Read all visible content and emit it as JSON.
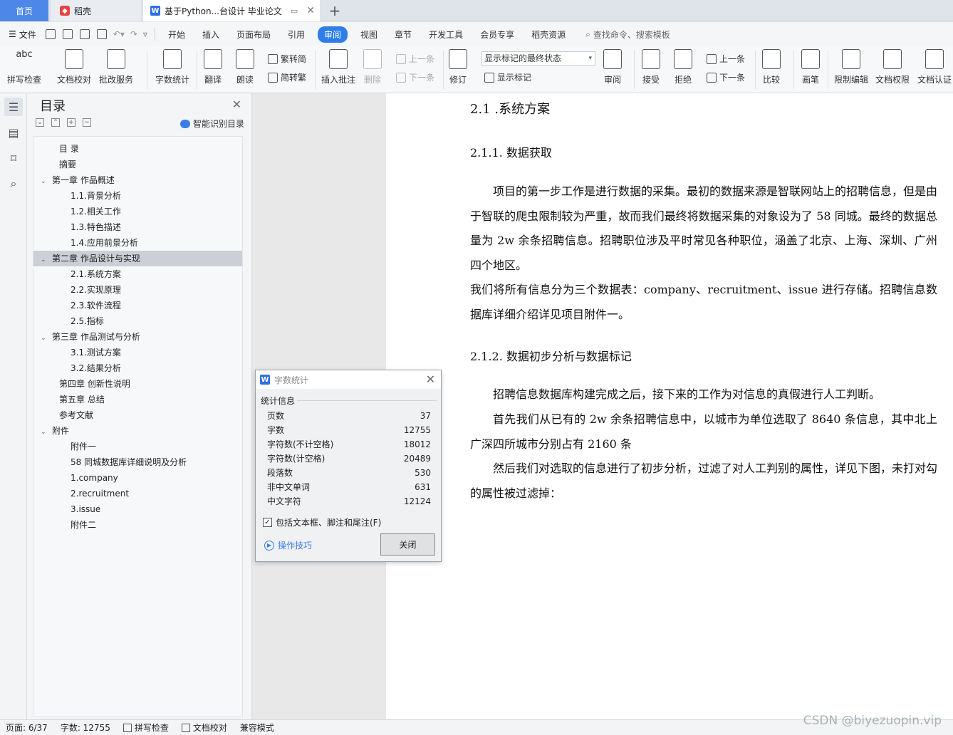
{
  "tabs": {
    "home": "首页",
    "daoke": "稻壳",
    "doc": "基于Python...台设计 毕业论文",
    "add": "+"
  },
  "menu": {
    "file": "文件",
    "items": [
      "开始",
      "插入",
      "页面布局",
      "引用",
      "审阅",
      "视图",
      "章节",
      "开发工具",
      "会员专享",
      "稻壳资源"
    ],
    "active": "审阅",
    "search": "查找命令、搜索模板"
  },
  "ribbon": {
    "spell": "拼写检查",
    "doccheck": "文档校对",
    "batch": "批改服务",
    "wordcount": "字数统计",
    "translate": "翻译",
    "read": "朗读",
    "trad": "繁转简",
    "simp": "简转繁",
    "insert_comment": "插入批注",
    "delete": "删除",
    "prev": "上一条",
    "next": "下一条",
    "revise": "修订",
    "display_select": "显示标记的最终状态",
    "show_markup": "显示标记",
    "review": "审阅",
    "accept": "接受",
    "reject": "拒绝",
    "prev2": "上一条",
    "next2": "下一条",
    "compare": "比较",
    "pen": "画笔",
    "restrict": "限制编辑",
    "rights": "文档权限",
    "auth": "文档认证",
    "abc": "abc"
  },
  "toc": {
    "title": "目录",
    "smart": "智能识别目录",
    "items": [
      {
        "label": "目 录",
        "level": 0,
        "arrow": ""
      },
      {
        "label": "摘要",
        "level": 0,
        "arrow": ""
      },
      {
        "label": "第一章 作品概述",
        "level": 0,
        "arrow": "v"
      },
      {
        "label": "1.1.背景分析",
        "level": 1,
        "arrow": ""
      },
      {
        "label": "1.2.相关工作",
        "level": 1,
        "arrow": ""
      },
      {
        "label": "1.3.特色描述",
        "level": 1,
        "arrow": ""
      },
      {
        "label": "1.4.应用前景分析",
        "level": 1,
        "arrow": ""
      },
      {
        "label": "第二章 作品设计与实现",
        "level": 0,
        "arrow": "v",
        "selected": true
      },
      {
        "label": "2.1.系统方案",
        "level": 1,
        "arrow": ""
      },
      {
        "label": "2.2.实现原理",
        "level": 1,
        "arrow": ""
      },
      {
        "label": "2.3.软件流程",
        "level": 1,
        "arrow": ""
      },
      {
        "label": "2.5.指标",
        "level": 1,
        "arrow": ""
      },
      {
        "label": "第三章 作品测试与分析",
        "level": 0,
        "arrow": "v"
      },
      {
        "label": "3.1.测试方案",
        "level": 1,
        "arrow": ""
      },
      {
        "label": "3.2.结果分析",
        "level": 1,
        "arrow": ""
      },
      {
        "label": "第四章 创新性说明",
        "level": 0,
        "arrow": ""
      },
      {
        "label": "第五章 总结",
        "level": 0,
        "arrow": ""
      },
      {
        "label": "参考文献",
        "level": 0,
        "arrow": ""
      },
      {
        "label": "附件",
        "level": 0,
        "arrow": "v"
      },
      {
        "label": "附件一",
        "level": 1,
        "arrow": ""
      },
      {
        "label": "58 同城数据库详细说明及分析",
        "level": 1,
        "arrow": ""
      },
      {
        "label": "1.company",
        "level": 1,
        "arrow": ""
      },
      {
        "label": "2.recruitment",
        "level": 1,
        "arrow": ""
      },
      {
        "label": "3.issue",
        "level": 1,
        "arrow": ""
      },
      {
        "label": "附件二",
        "level": 1,
        "arrow": ""
      }
    ]
  },
  "document": {
    "h2": "2.1 .系统方案",
    "h3a": "2.1.1.   数据获取",
    "p1": "项目的第一步工作是进行数据的采集。最初的数据来源是智联网站上的招聘信息，但是由于智联的爬虫限制较为严重，故而我们最终将数据采集的对象设为了 58 同城。最终的数据总量为 2w 余条招聘信息。招聘职位涉及平时常见各种职位，涵盖了北京、上海、深圳、广州四个地区。",
    "p2": "我们将所有信息分为三个数据表：company、recruitment、issue 进行存储。招聘信息数据库详细介绍详见项目附件一。",
    "h3b": "2.1.2.   数据初步分析与数据标记",
    "p3": "招聘信息数据库构建完成之后，接下来的工作为对信息的真假进行人工判断。",
    "p4": "首先我们从已有的 2w 余条招聘信息中，以城市为单位选取了 8640 条信息，其中北上广深四所城市分别占有 2160 条",
    "p5": "然后我们对选取的信息进行了初步分析，过滤了对人工判别的属性，详见下图，未打对勾的属性被过滤掉："
  },
  "dialog": {
    "title": "字数统计",
    "group": "统计信息",
    "rows": [
      {
        "label": "页数",
        "value": "37"
      },
      {
        "label": "字数",
        "value": "12755"
      },
      {
        "label": "字符数(不计空格)",
        "value": "18012"
      },
      {
        "label": "字符数(计空格)",
        "value": "20489"
      },
      {
        "label": "段落数",
        "value": "530"
      },
      {
        "label": "非中文单词",
        "value": "631"
      },
      {
        "label": "中文字符",
        "value": "12124"
      }
    ],
    "checkbox": "包括文本框、脚注和尾注(F)",
    "tip": "操作技巧",
    "close": "关闭"
  },
  "status": {
    "page": "页面: 6/37",
    "words": "字数: 12755",
    "spell": "拼写检查",
    "doccheck": "文档校对",
    "compat": "兼容模式"
  },
  "watermark": "CSDN @biyezuopin.vip"
}
